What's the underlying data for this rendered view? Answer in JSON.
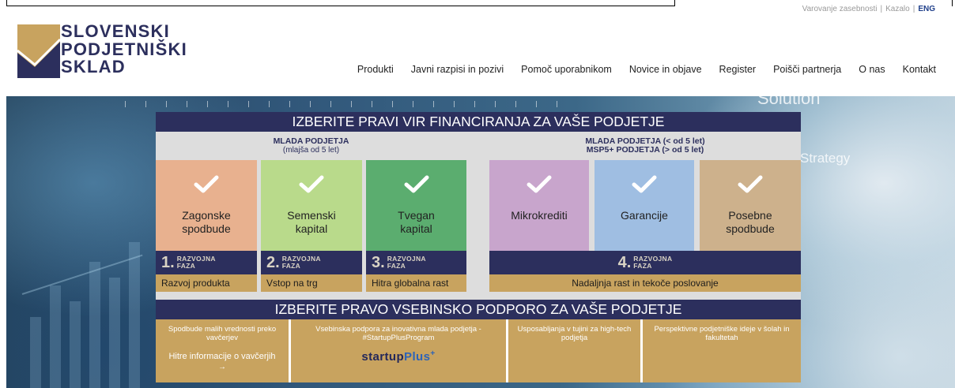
{
  "top_links": {
    "privacy": "Varovanje zasebnosti",
    "index": "Kazalo",
    "lang": "ENG",
    "separator": "|"
  },
  "logo": {
    "line1": "SLOVENSKI",
    "line2": "PODJETNIŠKI",
    "line3": "SKLAD",
    "icon": "sps-checkmark-logo-icon"
  },
  "nav": {
    "items": [
      {
        "label": "Produkti"
      },
      {
        "label": "Javni razpisi in pozivi"
      },
      {
        "label": "Pomoč uporabnikom"
      },
      {
        "label": "Novice in objave"
      },
      {
        "label": "Register"
      },
      {
        "label": "Poišči partnerja"
      },
      {
        "label": "O nas"
      },
      {
        "label": "Kontakt"
      }
    ]
  },
  "hero": {
    "bg_word_1": "Solution",
    "bg_word_2": "Strategy"
  },
  "financing": {
    "title": "IZBERITE PRAVI VIR FINANCIRANJA ZA VAŠE PODJETJE",
    "group_left": {
      "title": "MLADA PODJETJA",
      "subtitle": "(mlajša od 5 let)"
    },
    "group_right": {
      "title": "MLADA PODJETJA (< od 5 let)",
      "subtitle": "MSP5+ PODJETJA (> od 5 let)"
    },
    "cards": [
      {
        "label": "Zagonske spodbude",
        "icon": "check-icon",
        "color": "#e8b18f"
      },
      {
        "label": "Semenski kapital",
        "icon": "check-icon",
        "color": "#b9da8b"
      },
      {
        "label": "Tvegan kapital",
        "icon": "check-icon",
        "color": "#5bad6f"
      },
      {
        "label": "Mikrokrediti",
        "icon": "check-icon",
        "color": "#c8a5cc"
      },
      {
        "label": "Garancije",
        "icon": "check-icon",
        "color": "#9fbee2"
      },
      {
        "label": "Posebne spodbude",
        "icon": "check-icon",
        "color": "#cdb18c"
      }
    ],
    "phases": [
      {
        "number": "1.",
        "word_1": "RAZVOJNA",
        "word_2": "FAZA",
        "stage": "Razvoj produkta"
      },
      {
        "number": "2.",
        "word_1": "RAZVOJNA",
        "word_2": "FAZA",
        "stage": "Vstop na trg"
      },
      {
        "number": "3.",
        "word_1": "RAZVOJNA",
        "word_2": "FAZA",
        "stage": "Hitra globalna rast"
      },
      {
        "number": "4.",
        "word_1": "RAZVOJNA",
        "word_2": "FAZA",
        "stage": "Nadaljnja rast in tekoče poslovanje"
      }
    ]
  },
  "support": {
    "title": "IZBERITE PRAVO VSEBINSKO PODPORO ZA VAŠE PODJETJE",
    "boxes": [
      {
        "text": "Spodbude malih vrednosti preko vavčerjev",
        "link": "Hitre informacije o vavčerjih",
        "arrow": "→"
      },
      {
        "text": "Vsebinska podpora za inovativna mlada podjetja - #StartupPlusProgram",
        "logo_part_1": "startup",
        "logo_part_2": "Plus",
        "logo_part_3": "+"
      },
      {
        "text": "Usposabljanja v tujini za high-tech podjetja"
      },
      {
        "text": "Perspektivne podjetniške ideje v šolah in fakultetah"
      }
    ]
  },
  "colors": {
    "navy": "#2c2f5d",
    "gold": "#c8a35f",
    "panel_gray": "#dddddd",
    "link_blue": "#2a4f96"
  }
}
